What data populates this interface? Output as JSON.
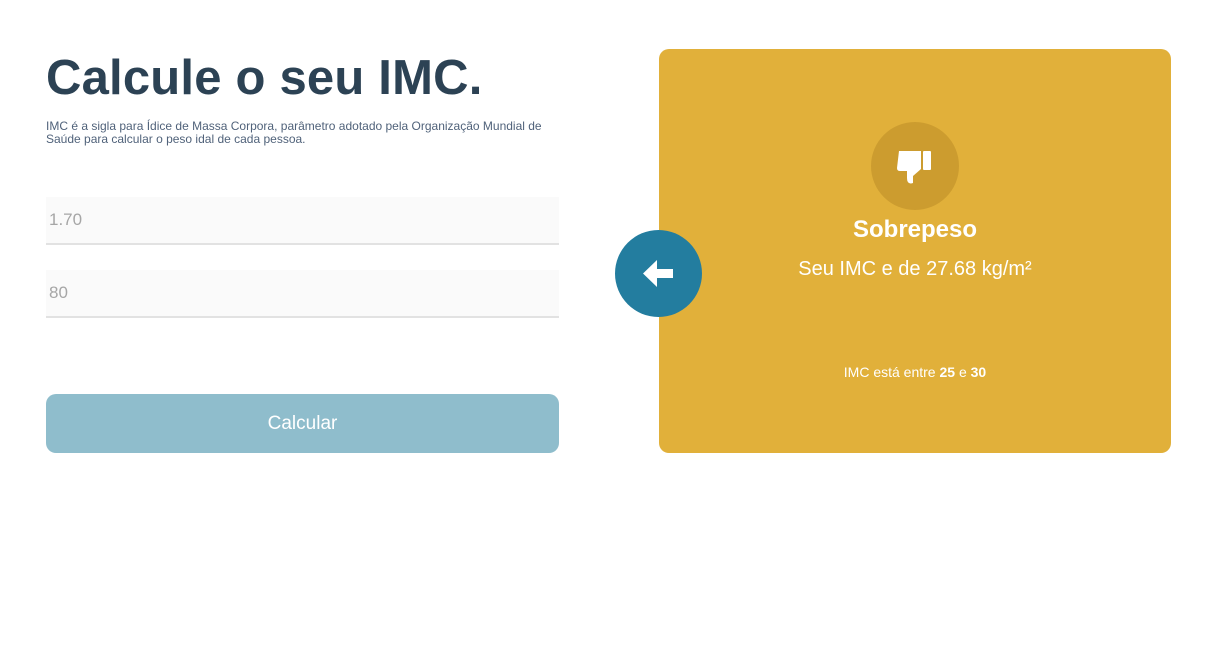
{
  "form": {
    "title": "Calcule o seu IMC.",
    "description": "IMC é a sigla para Ídice de Massa Corpora, parâmetro adotado pela Organização Mundial de Saúde para calcular o peso idal de cada pessoa.",
    "height_placeholder": "1.70",
    "weight_placeholder": "80",
    "calculate_label": "Calcular"
  },
  "result": {
    "status": "Sobrepeso",
    "imc_text": "Seu IMC e de 27.68 kg/m²",
    "range_prefix": "IMC está entre",
    "range_min": "25",
    "range_joiner": "e",
    "range_max": "30",
    "icon": "thumbs-down-icon",
    "card_color": "#e1b03a"
  },
  "back_button": {
    "icon": "arrow-left-icon",
    "color": "#237d9f"
  }
}
